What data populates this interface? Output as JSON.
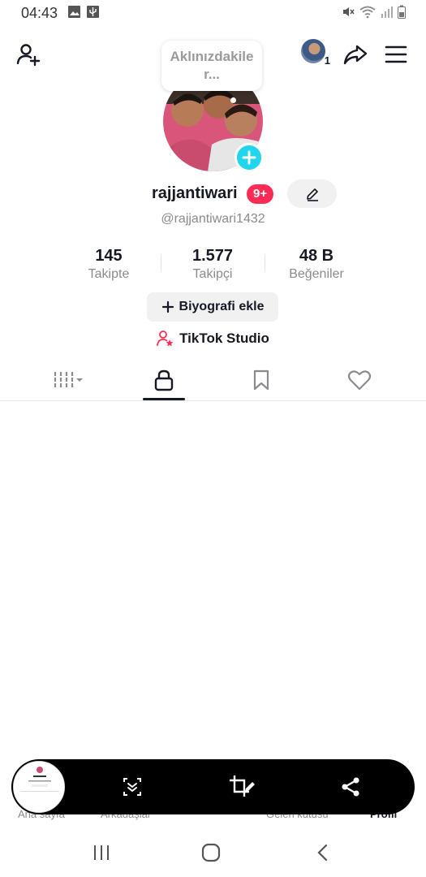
{
  "status_bar": {
    "time": "04:43",
    "left_icons": [
      "image-icon",
      "usb-icon"
    ],
    "right_icons": [
      "mute-icon",
      "wifi-icon",
      "signal-icon",
      "battery-icon"
    ]
  },
  "header": {
    "add_friend_icon": "add-user-icon",
    "account_count": "1",
    "share_icon": "share-arrow-icon",
    "menu_icon": "hamburger-menu-icon",
    "thought_bubble": "Aklınızdakile r..."
  },
  "profile": {
    "username": "rajjantiwari",
    "badge": "9+",
    "handle": "@rajjantiwari1432",
    "stats": [
      {
        "value": "145",
        "label": "Takipte"
      },
      {
        "value": "1.577",
        "label": "Takipçi"
      },
      {
        "value": "48 B",
        "label": "Beğeniler"
      }
    ],
    "bio_button": "Biyografi ekle",
    "studio_link": "TikTok Studio"
  },
  "tabs": {
    "items": [
      "videos-grid-icon",
      "private-lock-icon",
      "bookmark-icon",
      "heart-icon"
    ],
    "active": "private-lock-icon"
  },
  "bottom_nav": {
    "items": [
      "Ana sayfa",
      "Arkadaşlar",
      "Gelen kutusu",
      "Profil"
    ]
  },
  "screenshot_toolbar": {
    "items": [
      "scroll-capture-icon",
      "crop-edit-icon",
      "share-icon"
    ]
  },
  "colors": {
    "accent_red": "#fe2c55",
    "accent_cyan": "#20d5ec",
    "text_primary": "#161823",
    "text_secondary": "#8a8b91"
  }
}
